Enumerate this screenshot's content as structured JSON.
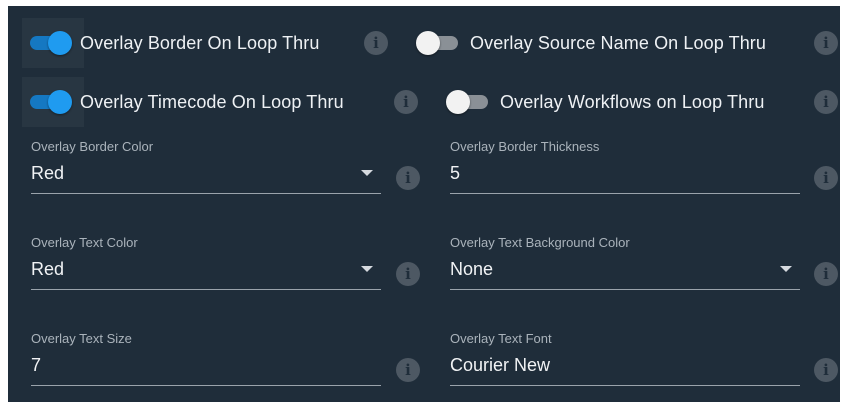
{
  "toggles": [
    {
      "label": "Overlay Border On Loop Thru",
      "on": true
    },
    {
      "label": "Overlay Source Name On Loop Thru",
      "on": false
    },
    {
      "label": "Overlay Timecode On Loop Thru",
      "on": true
    },
    {
      "label": "Overlay Workflows on Loop Thru",
      "on": false
    }
  ],
  "fields": {
    "border_color": {
      "label": "Overlay Border Color",
      "value": "Red",
      "type": "dropdown"
    },
    "border_thickness": {
      "label": "Overlay Border Thickness",
      "value": "5",
      "type": "input"
    },
    "text_color": {
      "label": "Overlay Text Color",
      "value": "Red",
      "type": "dropdown"
    },
    "text_bg_color": {
      "label": "Overlay Text Background Color",
      "value": "None",
      "type": "dropdown"
    },
    "text_size": {
      "label": "Overlay Text Size",
      "value": "7",
      "type": "input"
    },
    "text_font": {
      "label": "Overlay Text Font",
      "value": "Courier New",
      "type": "input"
    }
  },
  "icons": {
    "info": "info-icon",
    "dropdown": "chevron-down-icon"
  },
  "info_glyph": "i",
  "colors": {
    "panel_bg": "#1f2d3a",
    "switch_on": "#1f9bf0",
    "switch_off": "#f2f2f2",
    "info_icon": "#4d5863",
    "text": "#eef1f4",
    "label": "#aab3bb"
  }
}
